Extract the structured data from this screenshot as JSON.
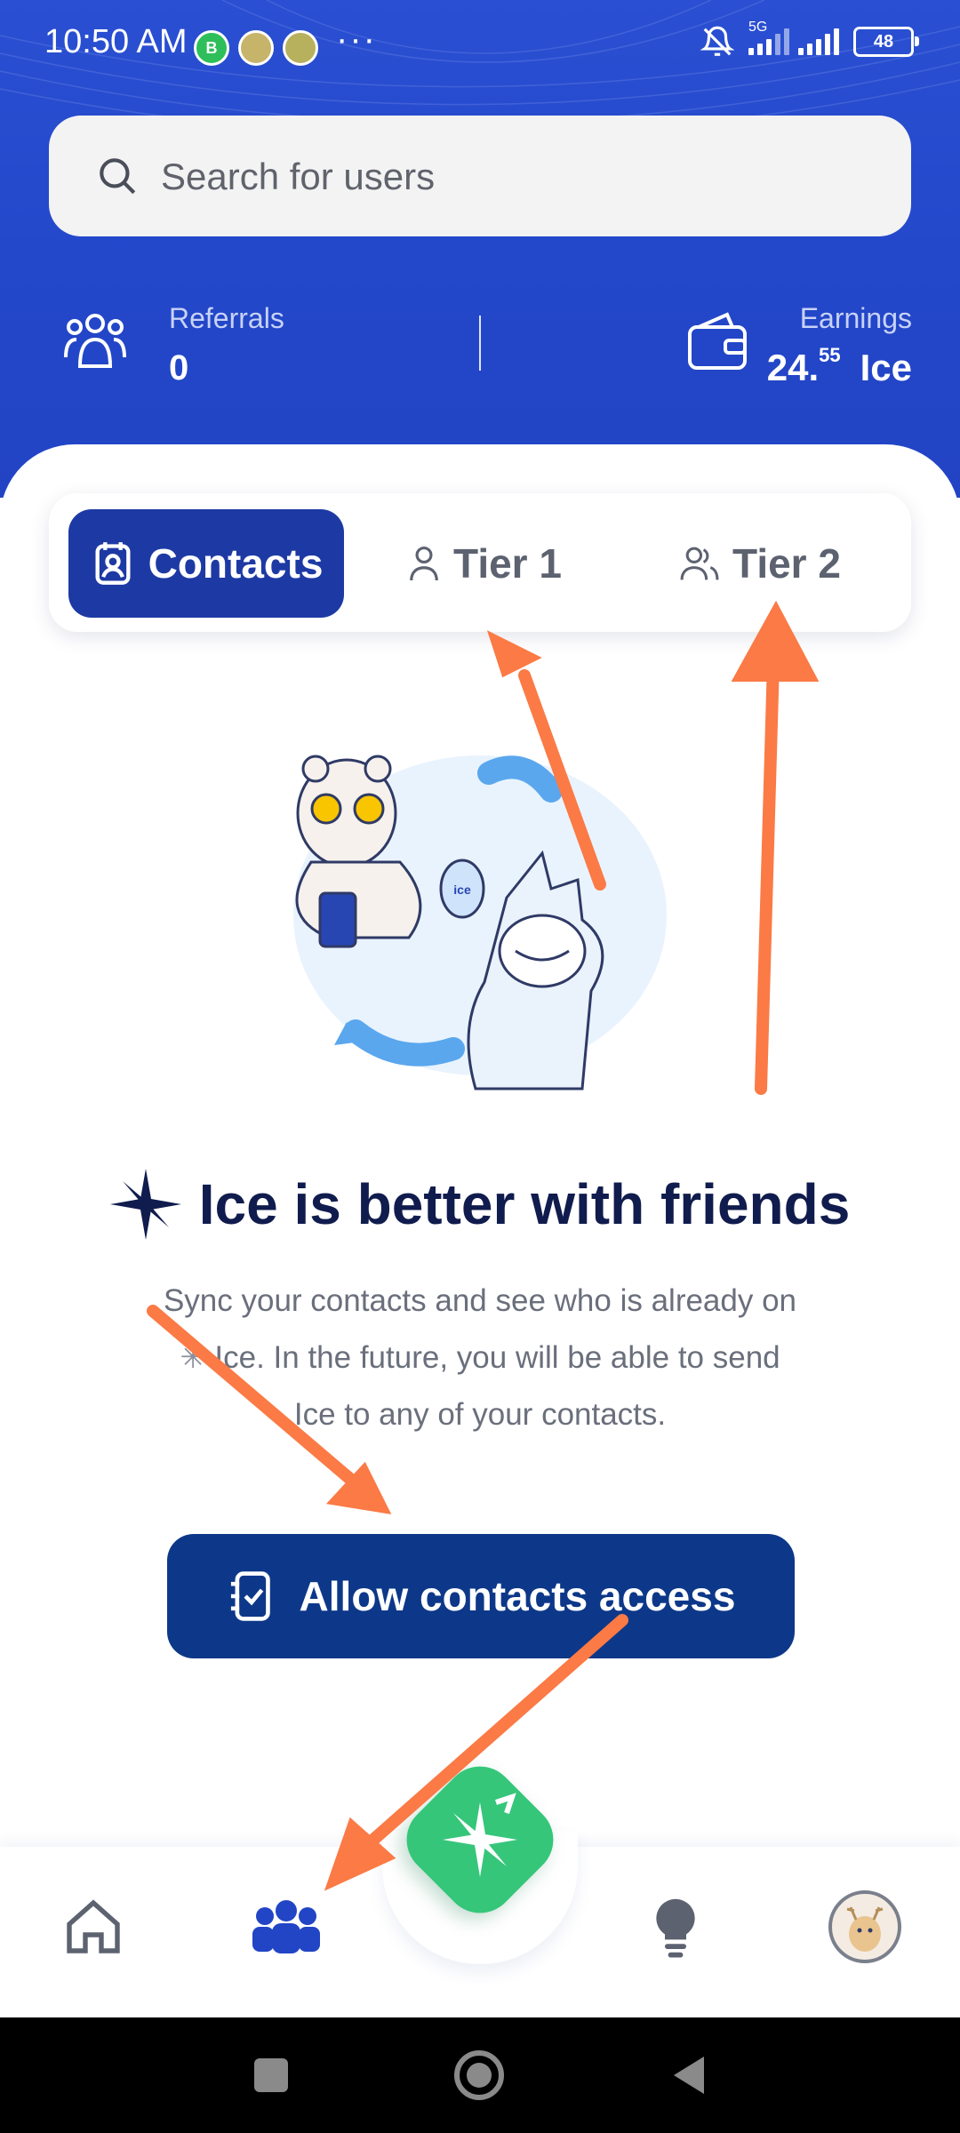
{
  "status_bar": {
    "time": "10:50 AM",
    "network": "5G",
    "battery": "48",
    "overflow": "···"
  },
  "search": {
    "placeholder": "Search for users"
  },
  "stats": {
    "referrals_label": "Referrals",
    "referrals_value": "0",
    "earnings_label": "Earnings",
    "earnings_whole": "24.",
    "earnings_fraction": "55",
    "earnings_unit": "Ice"
  },
  "tabs": [
    {
      "label": "Contacts",
      "icon": "contacts-icon",
      "active": true
    },
    {
      "label": "Tier 1",
      "icon": "user-icon",
      "active": false
    },
    {
      "label": "Tier 2",
      "icon": "users-icon",
      "active": false
    }
  ],
  "empty_state": {
    "title": "Ice is better with friends",
    "description_line1": "Sync your contacts and see who is already on",
    "description_line2": "Ice. In the future, you will be able to send",
    "description_line3": "Ice to any of your contacts.",
    "cta_label": "Allow contacts access",
    "illustration_bag_text": "ice"
  },
  "bottom_nav": [
    "home-icon",
    "team-icon",
    "mining-icon",
    "news-icon",
    "profile-avatar"
  ],
  "colors": {
    "header_blue": "#2347c9",
    "tab_active": "#1d3aa4",
    "cta": "#0d3889",
    "mining_green": "#35c67a",
    "annotation_arrow": "#fb7a45"
  }
}
